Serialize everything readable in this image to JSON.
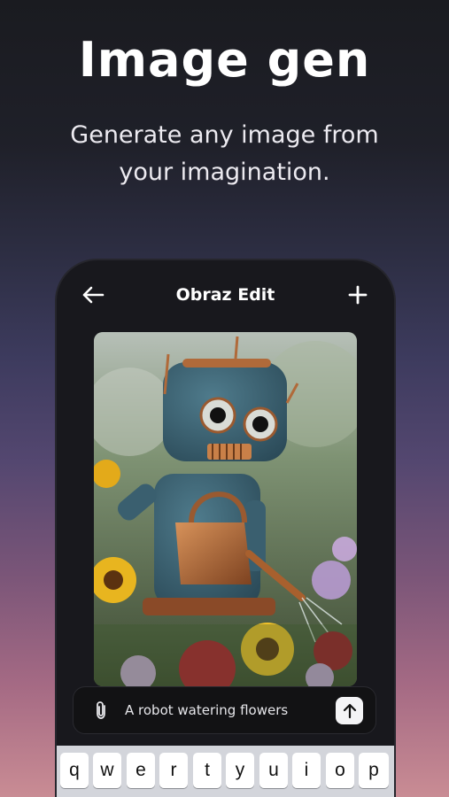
{
  "promo": {
    "title": "Image gen",
    "subtitle": "Generate any image from your imagination."
  },
  "app": {
    "nav": {
      "back_icon": "arrow-left-icon",
      "title": "Obraz Edit",
      "add_icon": "plus-icon"
    },
    "image": {
      "subject": "robot watering flowers"
    },
    "prompt": {
      "attach_icon": "paperclip-icon",
      "text": "A robot watering flowers",
      "send_icon": "arrow-up-icon"
    },
    "keyboard": {
      "row1": [
        "q",
        "w",
        "e",
        "r",
        "t",
        "y",
        "u",
        "i",
        "o",
        "p"
      ]
    }
  },
  "colors": {
    "phone_bg": "#18181d",
    "prompt_bg": "#121214",
    "send_button": "#f4f4f6",
    "keyboard_bg": "#d3d5db"
  }
}
